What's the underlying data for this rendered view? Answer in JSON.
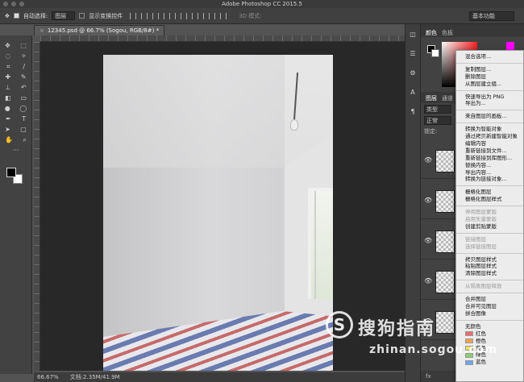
{
  "window": {
    "title": "Adobe Photoshop CC 2015.5"
  },
  "options_bar": {
    "auto_select_label": "自动选择:",
    "auto_select_target": "图层",
    "show_transform_label": "显示变换控件",
    "mode_3d_label": "3D 模式:",
    "workspace": "基本功能"
  },
  "document_tab": {
    "label": "12345.psd @ 66.7% (Sogou, RGB/8#) *",
    "close": "×"
  },
  "status_bar": {
    "zoom": "66.67%",
    "doc_size": "文档:2.35M/41.9M"
  },
  "panels": {
    "color_tabs": [
      "颜色",
      "色板"
    ],
    "layer_tabs": [
      "图层",
      "通道"
    ],
    "layer_filter": "类型",
    "blend_mode": "正常",
    "lock_label": "锁定:",
    "bottom_icons": "fx"
  },
  "context_menu": {
    "groups": [
      [
        {
          "label": "混合选项...",
          "enabled": true
        }
      ],
      [
        {
          "label": "复制图层...",
          "enabled": true
        },
        {
          "label": "删除图层",
          "enabled": true
        },
        {
          "label": "从图层建立组...",
          "enabled": true
        }
      ],
      [
        {
          "label": "快速导出为 PNG",
          "enabled": true
        },
        {
          "label": "导出为...",
          "enabled": true
        }
      ],
      [
        {
          "label": "来自图层的画板...",
          "enabled": true
        }
      ],
      [
        {
          "label": "转换为智能对象",
          "enabled": true
        },
        {
          "label": "通过拷贝新建智能对象",
          "enabled": true
        },
        {
          "label": "编辑内容",
          "enabled": true
        },
        {
          "label": "重新链接到文件...",
          "enabled": true
        },
        {
          "label": "重新链接到库图形...",
          "enabled": true
        },
        {
          "label": "替换内容...",
          "enabled": true
        },
        {
          "label": "导出内容...",
          "enabled": true
        },
        {
          "label": "转换为链接对象...",
          "enabled": true
        }
      ],
      [
        {
          "label": "栅格化图层",
          "enabled": true
        },
        {
          "label": "栅格化图层样式",
          "enabled": true
        }
      ],
      [
        {
          "label": "停用图层蒙版",
          "enabled": false
        },
        {
          "label": "启用矢量蒙版",
          "enabled": false
        },
        {
          "label": "创建剪贴蒙版",
          "enabled": true
        }
      ],
      [
        {
          "label": "链接图层",
          "enabled": false
        },
        {
          "label": "选择链接图层",
          "enabled": false
        }
      ],
      [
        {
          "label": "拷贝图层样式",
          "enabled": true
        },
        {
          "label": "粘贴图层样式",
          "enabled": true
        },
        {
          "label": "清除图层样式",
          "enabled": true
        }
      ],
      [
        {
          "label": "从隔离图层释放",
          "enabled": false
        }
      ],
      [
        {
          "label": "合并图层",
          "enabled": true
        },
        {
          "label": "合并可见图层",
          "enabled": true
        },
        {
          "label": "拼合图像",
          "enabled": true
        }
      ],
      [
        {
          "label": "无颜色",
          "enabled": true
        },
        {
          "label": "红色",
          "enabled": true,
          "color": "#f06a6a"
        },
        {
          "label": "橙色",
          "enabled": true,
          "color": "#f5a04a"
        },
        {
          "label": "黄色",
          "enabled": true,
          "color": "#f0e05a"
        },
        {
          "label": "绿色",
          "enabled": true,
          "color": "#8ad06a"
        },
        {
          "label": "蓝色",
          "enabled": true,
          "color": "#6aa8f0"
        }
      ]
    ]
  },
  "watermark": {
    "logo": "S",
    "name": "搜狗指南",
    "url": "zhinan.sogou.com"
  },
  "colors": {
    "app_bg": "#535353",
    "canvas_bg": "#282828",
    "menu_bg": "#ececec"
  }
}
